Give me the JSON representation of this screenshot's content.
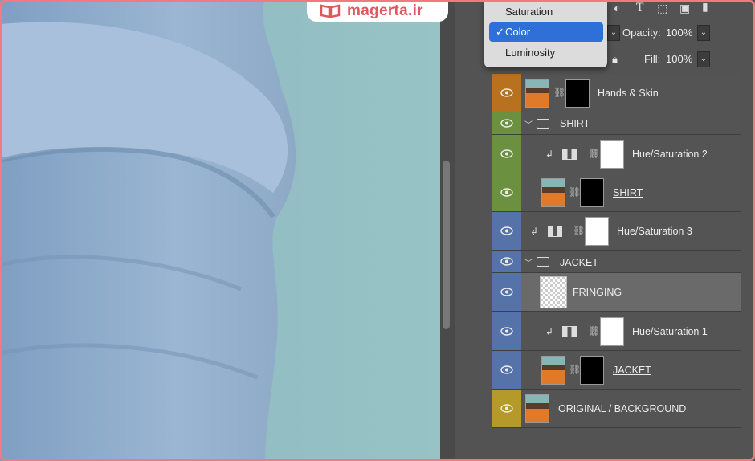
{
  "watermark": {
    "text": "magerta.ir"
  },
  "blend_menu": {
    "items": [
      {
        "label": "Saturation",
        "checked": false
      },
      {
        "label": "Color",
        "checked": true
      },
      {
        "label": "Luminosity",
        "checked": false
      }
    ],
    "check_glyph": "✓"
  },
  "opacity": {
    "label": "Opacity:",
    "value": "100%"
  },
  "fill": {
    "label": "Fill:",
    "value": "100%"
  },
  "layers": [
    {
      "name": "Hands & Skin",
      "color": "#b8711e",
      "type": "photo-mask"
    },
    {
      "name": "SHIRT",
      "color": "#6b9140",
      "type": "group"
    },
    {
      "name": "Hue/Saturation 2",
      "color": "#6b9140",
      "type": "adjustment"
    },
    {
      "name": "SHIRT",
      "color": "#6b9140",
      "type": "photo-mask"
    },
    {
      "name": "Hue/Saturation 3",
      "color": "#5573a8",
      "type": "adjustment"
    },
    {
      "name": "JACKET",
      "color": "#5573a8",
      "type": "group"
    },
    {
      "name": "FRINGING",
      "color": "#5573a8",
      "type": "empty"
    },
    {
      "name": "Hue/Saturation 1",
      "color": "#5573a8",
      "type": "adjustment"
    },
    {
      "name": "JACKET",
      "color": "#5573a8",
      "type": "photo-mask"
    },
    {
      "name": "ORIGINAL / BACKGROUND",
      "color": "#b59a2a",
      "type": "photo"
    }
  ],
  "icons": {
    "eye": "eye-icon",
    "link": "chain-link-icon",
    "clip": "clipping-arrow-icon",
    "folder": "folder-icon",
    "lock": "lock-icon",
    "chevron": "chevron-down-icon"
  }
}
